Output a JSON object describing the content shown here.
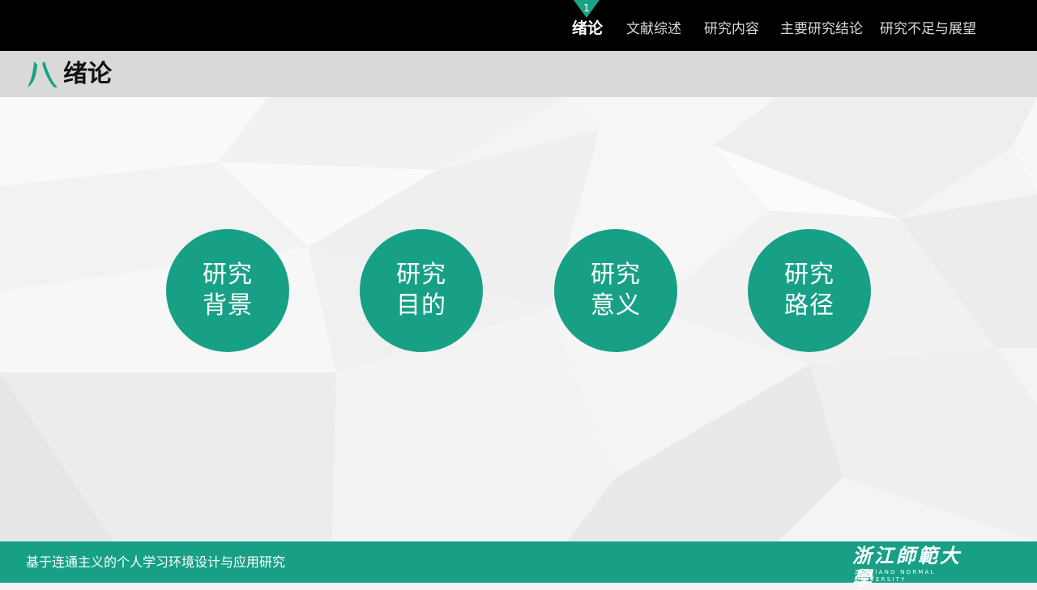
{
  "nav": {
    "marker_number": "1",
    "items": [
      {
        "label": "绪论"
      },
      {
        "label": "文献综述"
      },
      {
        "label": "研究内容"
      },
      {
        "label": "主要研究结论"
      },
      {
        "label": "研究不足与展望"
      }
    ]
  },
  "section": {
    "title": "绪论"
  },
  "circles": [
    {
      "line1": "研究",
      "line2": "背景"
    },
    {
      "line1": "研究",
      "line2": "目的"
    },
    {
      "line1": "研究",
      "line2": "意义"
    },
    {
      "line1": "研究",
      "line2": "路径"
    }
  ],
  "footer": {
    "title": "基于连通主义的个人学习环境设计与应用研究",
    "logo_cn": "浙江師範大學",
    "logo_en": "ZHEJIANG NORMAL UNIVERSITY"
  },
  "colors": {
    "accent": "#17a086",
    "topbar": "#000000",
    "header": "#d9d9d9"
  }
}
